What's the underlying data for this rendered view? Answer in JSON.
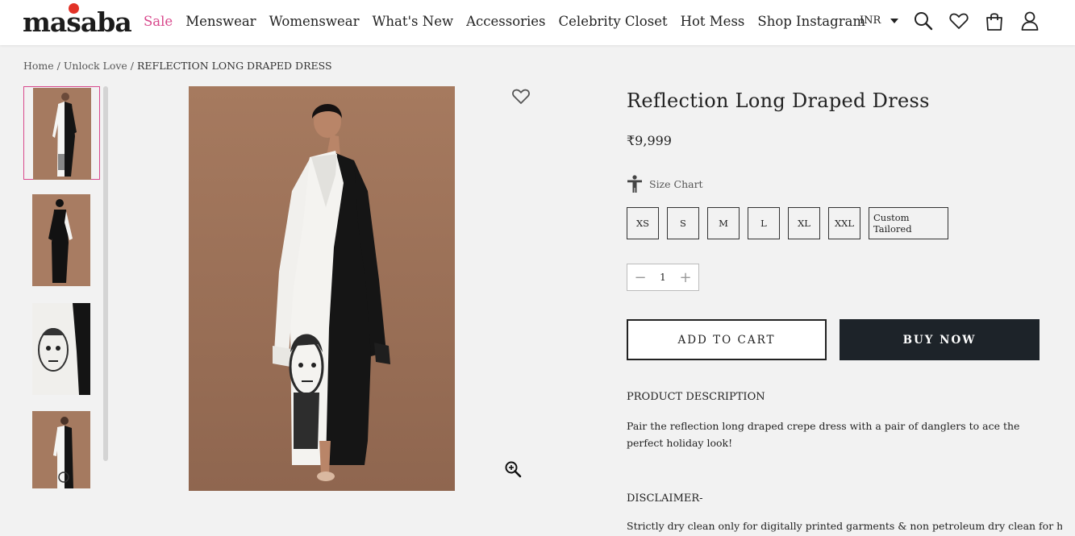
{
  "header": {
    "logo_text": "masaba",
    "nav": [
      "Sale",
      "Menswear",
      "Womenswear",
      "What's New",
      "Accessories",
      "Celebrity Closet",
      "Hot Mess",
      "Shop Instagram"
    ],
    "currency": "INR",
    "icons": [
      "search-icon",
      "heart-icon",
      "bag-icon",
      "user-icon"
    ]
  },
  "breadcrumb": {
    "home": "Home",
    "sep1": " / ",
    "collection": "Unlock Love",
    "sep2": " / ",
    "current": "REFLECTION LONG DRAPED DRESS"
  },
  "product": {
    "title": "Reflection Long Draped Dress",
    "price": "₹9,999",
    "size_chart_label": "Size Chart",
    "sizes": [
      "XS",
      "S",
      "M",
      "L",
      "XL",
      "XXL",
      "Custom Tailored"
    ],
    "quantity": "1",
    "add_to_cart": "ADD TO CART",
    "buy_now": "BUY NOW",
    "description_heading": "PRODUCT DESCRIPTION",
    "description": "Pair the reflection long draped crepe dress with a pair of danglers to ace the perfect holiday look!",
    "disclaimer_heading": "DISCLAIMER-",
    "disclaimer": "Strictly dry clean only for digitally printed garments & non petroleum dry clean for hand"
  },
  "colors": {
    "accent_pink": "#d8488c",
    "logo_red": "#e23227",
    "buy_button": "#1d2329",
    "background": "#f2f2f2"
  }
}
